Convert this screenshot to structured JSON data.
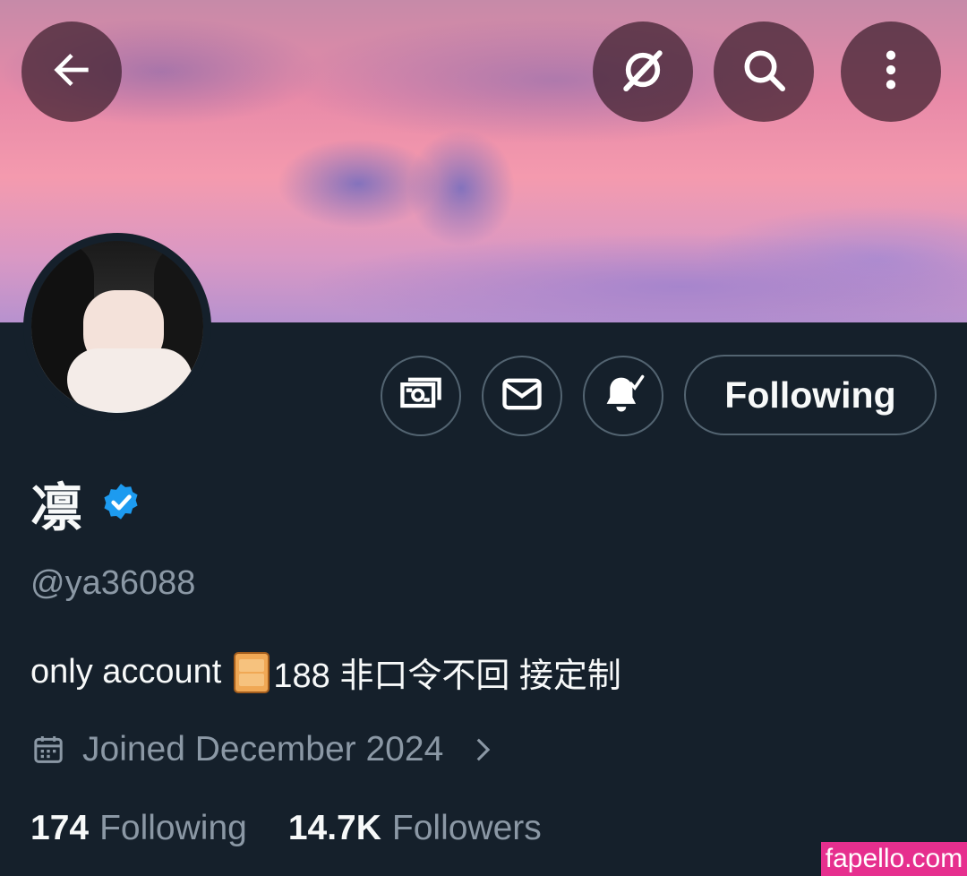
{
  "header": {
    "back_icon": "arrow-left-icon",
    "grok_icon": "grok-icon",
    "search_icon": "search-icon",
    "more_icon": "more-vertical-icon"
  },
  "profile": {
    "display_name": "凛",
    "verified": true,
    "verified_color": "#1d9bf0",
    "handle": "@ya36088",
    "bio_prefix": "only account",
    "bio_emoji": "door-emoji",
    "bio_suffix": "188 非口令不回 接定制",
    "joined": "Joined December 2024"
  },
  "actions": {
    "subscribe_icon": "money-icon",
    "message_icon": "mail-icon",
    "notifications_icon": "bell-check-icon",
    "following_label": "Following"
  },
  "stats": {
    "following_count": "174",
    "following_label": "Following",
    "followers_count": "14.7K",
    "followers_label": "Followers"
  },
  "watermark": "fapello.com",
  "colors": {
    "background": "#15202b",
    "secondary_text": "#8b98a5",
    "border": "#536471",
    "watermark_bg": "#e62f8e"
  }
}
